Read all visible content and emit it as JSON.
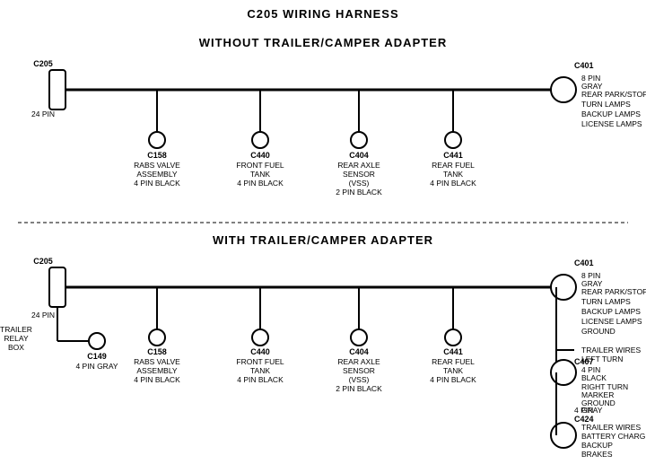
{
  "title": "C205 WIRING HARNESS",
  "top_section": {
    "label": "WITHOUT TRAILER/CAMPER ADAPTER",
    "left_connector": {
      "name": "C205",
      "pins": "24 PIN"
    },
    "right_connector": {
      "name": "C401",
      "pins": "8 PIN",
      "color": "GRAY"
    },
    "right_labels": [
      "REAR PARK/STOP",
      "TURN LAMPS",
      "BACKUP LAMPS",
      "LICENSE LAMPS"
    ],
    "connectors": [
      {
        "name": "C158",
        "line1": "RABS VALVE",
        "line2": "ASSEMBLY",
        "line3": "4 PIN BLACK"
      },
      {
        "name": "C440",
        "line1": "FRONT FUEL",
        "line2": "TANK",
        "line3": "4 PIN BLACK"
      },
      {
        "name": "C404",
        "line1": "REAR AXLE",
        "line2": "SENSOR",
        "line3": "(VSS)",
        "line4": "2 PIN BLACK"
      },
      {
        "name": "C441",
        "line1": "REAR FUEL",
        "line2": "TANK",
        "line3": "4 PIN BLACK"
      }
    ]
  },
  "bottom_section": {
    "label": "WITH TRAILER/CAMPER ADAPTER",
    "left_connector": {
      "name": "C205",
      "pins": "24 PIN"
    },
    "extra_left": {
      "relay": "TRAILER",
      "relay2": "RELAY",
      "relay3": "BOX",
      "name": "C149",
      "pins": "4 PIN GRAY"
    },
    "right_connector": {
      "name": "C401",
      "pins": "8 PIN",
      "color": "GRAY"
    },
    "right_labels": [
      "REAR PARK/STOP",
      "TURN LAMPS",
      "BACKUP LAMPS",
      "LICENSE LAMPS",
      "GROUND"
    ],
    "right_c407": {
      "name": "C407",
      "pins": "4 PIN",
      "color": "BLACK"
    },
    "right_c407_labels": [
      "TRAILER WIRES",
      "LEFT TURN",
      "RIGHT TURN",
      "MARKER",
      "GROUND"
    ],
    "right_c424": {
      "name": "C424",
      "pins": "4 PIN",
      "color": "GRAY"
    },
    "right_c424_labels": [
      "TRAILER WIRES",
      "BATTERY CHARGE",
      "BACKUP",
      "BRAKES"
    ],
    "connectors": [
      {
        "name": "C158",
        "line1": "RABS VALVE",
        "line2": "ASSEMBLY",
        "line3": "4 PIN BLACK"
      },
      {
        "name": "C440",
        "line1": "FRONT FUEL",
        "line2": "TANK",
        "line3": "4 PIN BLACK"
      },
      {
        "name": "C404",
        "line1": "REAR AXLE",
        "line2": "SENSOR",
        "line3": "(VSS)",
        "line4": "2 PIN BLACK"
      },
      {
        "name": "C441",
        "line1": "REAR FUEL",
        "line2": "TANK",
        "line3": "4 PIN BLACK"
      }
    ]
  }
}
